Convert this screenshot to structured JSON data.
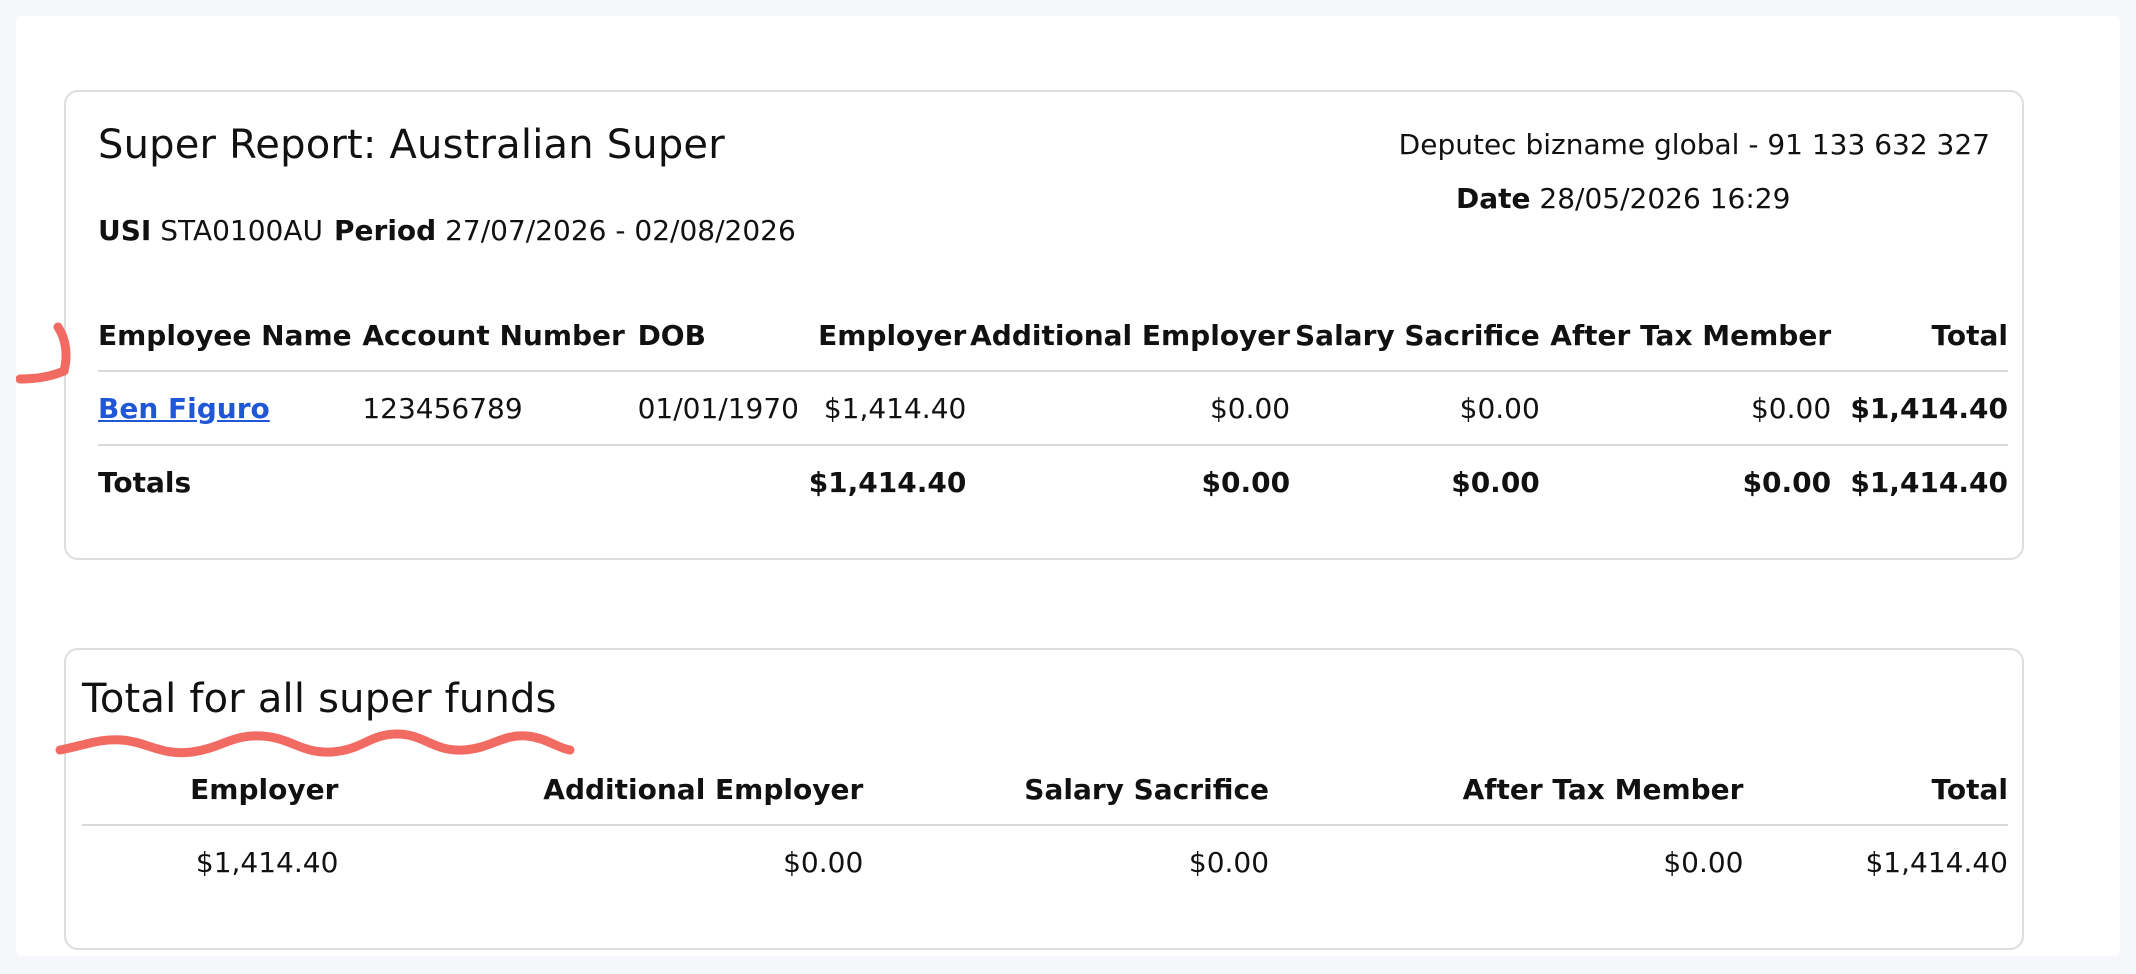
{
  "report": {
    "title": "Super Report: Australian Super",
    "usi_label": "USI",
    "usi_value": "STA0100AU",
    "period_label": "Period",
    "period_value": "27/07/2026 - 02/08/2026",
    "business": "Deputec bizname global - 91 133 632 327",
    "date_label": "Date",
    "date_value": "28/05/2026 16:29",
    "columns": [
      "Employee Name",
      "Account Number",
      "DOB",
      "Employer",
      "Additional Employer",
      "Salary Sacrifice",
      "After Tax Member",
      "Total"
    ],
    "rows": [
      {
        "name": "Ben Figuro",
        "account": "123456789",
        "dob": "01/01/1970",
        "employer": "$1,414.40",
        "additional": "$0.00",
        "salary": "$0.00",
        "after_tax": "$0.00",
        "total": "$1,414.40"
      }
    ],
    "totals": {
      "label": "Totals",
      "employer": "$1,414.40",
      "additional": "$0.00",
      "salary": "$0.00",
      "after_tax": "$0.00",
      "total": "$1,414.40"
    }
  },
  "all_funds": {
    "title": "Total for all super funds",
    "columns": [
      "Employer",
      "Additional Employer",
      "Salary Sacrifice",
      "After Tax Member",
      "Total"
    ],
    "values": [
      "$1,414.40",
      "$0.00",
      "$0.00",
      "$0.00",
      "$1,414.40"
    ]
  },
  "colors": {
    "link": "#1f57d6",
    "annotation": "#f26b62"
  }
}
